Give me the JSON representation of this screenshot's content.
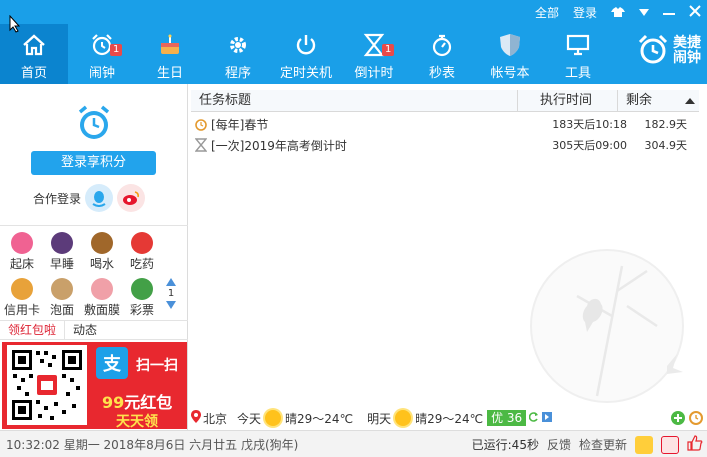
{
  "header": {
    "window_controls": {
      "all": "全部",
      "login": "登录"
    },
    "nav": [
      {
        "label": "首页",
        "icon": "home-icon",
        "active": true
      },
      {
        "label": "闹钟",
        "icon": "alarm-clock-icon",
        "badge": "1"
      },
      {
        "label": "生日",
        "icon": "cake-icon"
      },
      {
        "label": "程序",
        "icon": "gear-icon"
      },
      {
        "label": "定时关机",
        "icon": "power-icon"
      },
      {
        "label": "倒计时",
        "icon": "hourglass-icon",
        "badge": "1"
      },
      {
        "label": "秒表",
        "icon": "stopwatch-icon"
      },
      {
        "label": "帐号本",
        "icon": "shield-icon"
      },
      {
        "label": "工具",
        "icon": "monitor-icon"
      }
    ],
    "brand": {
      "line1": "美捷",
      "line2": "闹钟"
    }
  },
  "sidebar": {
    "login_button": "登录享积分",
    "coop_login": "合作登录",
    "shortcuts": [
      {
        "label": "起床",
        "color": "#f06292"
      },
      {
        "label": "早睡",
        "color": "#5c3b7a"
      },
      {
        "label": "喝水",
        "color": "#a0672a"
      },
      {
        "label": "吃药",
        "color": "#e53935"
      },
      {
        "label": "信用卡",
        "color": "#e8a23a"
      },
      {
        "label": "泡面",
        "color": "#c9a06a"
      },
      {
        "label": "敷面膜",
        "color": "#f0a0a8"
      },
      {
        "label": "彩票",
        "color": "#43a047"
      }
    ],
    "page": "1",
    "tabs": [
      "领红包啦",
      "动态"
    ],
    "ad": {
      "scan": "扫一扫",
      "amount": "99",
      "amount_unit": "元红包",
      "daily": "天天领",
      "alipay_glyph": "支"
    }
  },
  "tasks": {
    "columns": [
      "任务标题",
      "执行时间",
      "剩余"
    ],
    "rows": [
      {
        "title": "[每年]春节",
        "time": "183天后10:18",
        "remain": "182.9天",
        "icon": "alarm-clock-icon"
      },
      {
        "title": "[一次]2019年高考倒计时",
        "time": "305天后09:00",
        "remain": "304.9天",
        "icon": "hourglass-icon"
      }
    ]
  },
  "weather": {
    "city": "北京",
    "today_label": "今天",
    "today_temp": "晴29～24℃",
    "tomorrow_label": "明天",
    "tomorrow_temp": "晴29～24℃",
    "aqi": "优 36"
  },
  "statusbar": {
    "datetime": "10:32:02 星期一 2018年8月6日 六月廿五 戊戌(狗年)",
    "running": "已运行:45秒",
    "feedback": "反馈",
    "check_update": "检查更新"
  }
}
